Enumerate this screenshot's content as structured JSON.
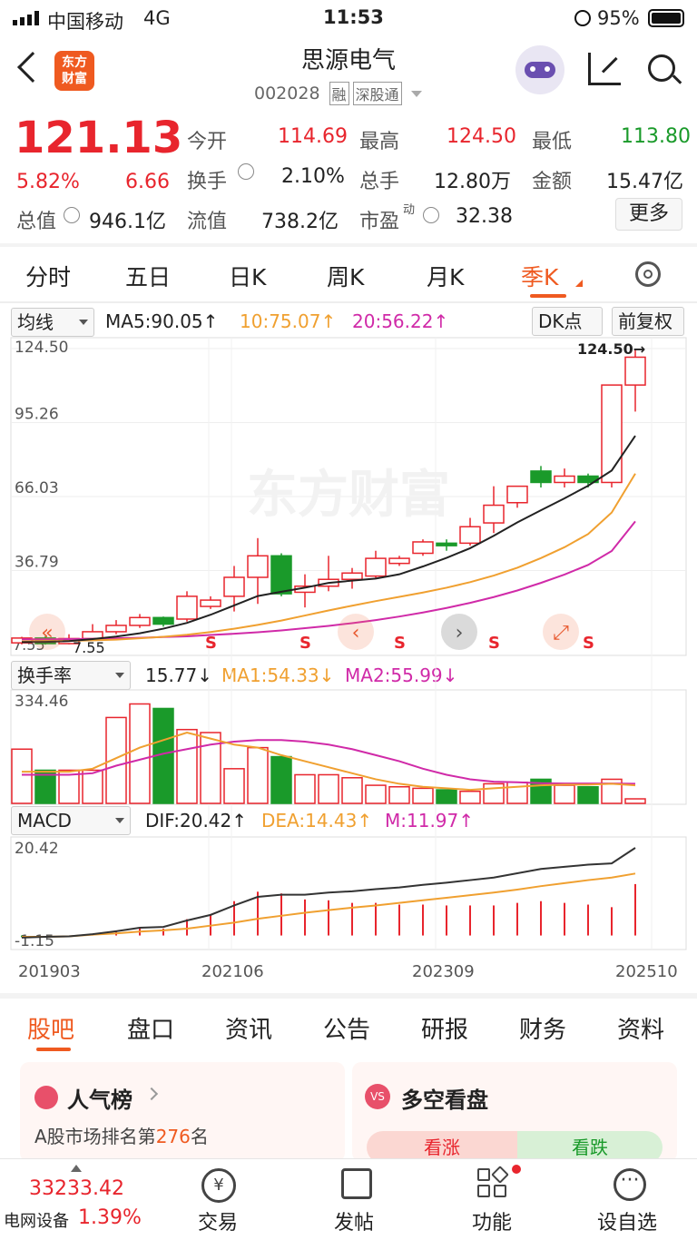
{
  "status": {
    "carrier": "中国移动",
    "network": "4G",
    "time": "11:53",
    "battery": "95%"
  },
  "nav": {
    "logo_line1": "东方",
    "logo_line2": "财富",
    "title": "思源电气",
    "code": "002028",
    "tag1": "融",
    "tag2": "深股通"
  },
  "quote": {
    "price": "121.13",
    "change_pct": "5.82%",
    "change": "6.66",
    "rows": [
      [
        {
          "label": "今开",
          "value": "114.69"
        },
        {
          "label": "最高",
          "value": "124.50"
        },
        {
          "label": "最低",
          "value": "113.80"
        }
      ],
      [
        {
          "label": "换手",
          "value": "2.10%"
        },
        {
          "label": "总手",
          "value": "12.80万"
        },
        {
          "label": "金额",
          "value": "15.47亿"
        }
      ],
      [
        {
          "label": "流值",
          "value": "738.2亿"
        },
        {
          "label": "市盈",
          "sup": "动",
          "value": "32.38"
        }
      ]
    ],
    "total_value_label": "总值",
    "total_value": "946.1亿",
    "more": "更多"
  },
  "tabs": [
    "分时",
    "五日",
    "日K",
    "周K",
    "月K",
    "季K"
  ],
  "active_tab": "季K",
  "ma_bar": {
    "select": "均线",
    "ma5": "MA5:90.05↑",
    "ma10": "10:75.07↑",
    "ma20": "20:56.22↑",
    "dk": "DK点",
    "adj": "前复权"
  },
  "vol_bar": {
    "select": "换手率",
    "val": "15.77↓",
    "ma1": "MA1:54.33↓",
    "ma2": "MA2:55.99↓"
  },
  "macd_bar": {
    "select": "MACD",
    "dif": "DIF:20.42↑",
    "dea": "DEA:14.43↑",
    "m": "M:11.97↑"
  },
  "chart_data": [
    {
      "type": "candlestick",
      "price_axis_labels": [
        "124.50",
        "95.26",
        "66.03",
        "36.79",
        "7.55"
      ],
      "high_marker": "124.50→",
      "low_marker": "7.55",
      "watermark": "东方财富",
      "candles": [
        [
          8.2,
          10.1,
          7.6,
          10.6
        ],
        [
          10.1,
          7.9,
          7.5,
          10.9
        ],
        [
          7.9,
          9.9,
          7.6,
          11.6
        ],
        [
          9.9,
          12.6,
          9.4,
          15.6
        ],
        [
          12.6,
          15.1,
          11.6,
          17.2
        ],
        [
          15.1,
          18.2,
          14.1,
          19.6
        ],
        [
          18.2,
          15.6,
          14.6,
          18.6
        ],
        [
          17.6,
          26.6,
          16.6,
          28.6
        ],
        [
          22.6,
          25.1,
          21.6,
          26.6
        ],
        [
          26.6,
          34.1,
          20.6,
          38.6
        ],
        [
          34.1,
          42.6,
          23.6,
          49.6
        ],
        [
          42.6,
          27.6,
          26.6,
          43.6
        ],
        [
          28.2,
          30.6,
          22.2,
          35.3
        ],
        [
          30.6,
          33.3,
          28.6,
          42.6
        ],
        [
          33.3,
          35.8,
          29.6,
          37.8
        ],
        [
          34.6,
          41.6,
          33.6,
          44.6
        ],
        [
          39.6,
          41.6,
          38.6,
          42.6
        ],
        [
          43.6,
          48.1,
          42.6,
          49.1
        ],
        [
          47.6,
          46.6,
          44.6,
          49.1
        ],
        [
          47.6,
          54.1,
          46.6,
          57.6
        ],
        [
          55.6,
          62.6,
          51.6,
          70.1
        ],
        [
          63.6,
          70.1,
          61.6,
          70.1
        ],
        [
          76.1,
          71.6,
          69.6,
          78.1
        ],
        [
          71.6,
          74.1,
          69.6,
          77.1
        ],
        [
          74.1,
          71.6,
          69.6,
          75.1
        ],
        [
          71.6,
          110.1,
          69.6,
          110.1
        ],
        [
          110.1,
          121.1,
          99.6,
          124.5
        ]
      ],
      "ma5": [
        8.5,
        8.6,
        8.9,
        9.7,
        10.7,
        12.0,
        13.8,
        16.1,
        19.3,
        23.0,
        26.7,
        28.4,
        30.0,
        31.9,
        32.8,
        33.6,
        35.3,
        38.4,
        41.8,
        45.6,
        50.5,
        55.8,
        60.6,
        65.3,
        70.3,
        76.3,
        90.05
      ],
      "ma10": [
        8.8,
        8.9,
        9.0,
        9.2,
        9.5,
        10.0,
        10.6,
        11.4,
        12.5,
        13.8,
        15.3,
        17.0,
        19.0,
        21.0,
        22.9,
        24.7,
        26.4,
        28.1,
        30.0,
        32.2,
        34.8,
        37.9,
        41.7,
        46.0,
        51.2,
        59.7,
        75.07
      ],
      "ma20": [
        9.6,
        9.6,
        9.7,
        9.8,
        10.0,
        10.2,
        10.5,
        10.8,
        11.3,
        11.8,
        12.4,
        13.1,
        14.0,
        14.9,
        16.0,
        17.2,
        18.6,
        20.2,
        22.0,
        24.0,
        26.3,
        28.9,
        31.9,
        35.2,
        39.0,
        44.5,
        56.22
      ],
      "signals": [
        8,
        12,
        16,
        20,
        24
      ],
      "volume_axis_label": "334.46",
      "volume": [
        180,
        110,
        110,
        110,
        285,
        330,
        315,
        245,
        235,
        115,
        185,
        155,
        95,
        95,
        85,
        60,
        55,
        50,
        45,
        40,
        65,
        70,
        80,
        60,
        55,
        80,
        15
      ],
      "vol_ma1": [
        105,
        105,
        105,
        115,
        150,
        185,
        210,
        235,
        215,
        195,
        185,
        160,
        140,
        120,
        100,
        80,
        65,
        55,
        50,
        45,
        50,
        55,
        60,
        62,
        62,
        65,
        60
      ],
      "vol_ma2": [
        95,
        95,
        95,
        100,
        125,
        145,
        165,
        180,
        195,
        205,
        210,
        210,
        205,
        195,
        180,
        160,
        140,
        115,
        95,
        80,
        72,
        70,
        67,
        66,
        66,
        66,
        65
      ],
      "macd_axis_labels": [
        "20.42",
        "-1.15"
      ],
      "dif": [
        -0.5,
        -0.3,
        -0.2,
        0.3,
        1.0,
        1.8,
        2.0,
        3.5,
        4.8,
        7.0,
        9.0,
        9.5,
        9.5,
        10.0,
        10.3,
        10.8,
        11.2,
        11.8,
        12.3,
        12.9,
        13.5,
        14.5,
        15.5,
        16.0,
        16.5,
        16.8,
        20.42
      ],
      "dea": [
        -0.3,
        -0.3,
        -0.2,
        0.2,
        0.5,
        0.9,
        1.2,
        1.6,
        2.3,
        3.0,
        3.9,
        4.6,
        5.3,
        5.9,
        6.5,
        7.0,
        7.6,
        8.2,
        8.8,
        9.4,
        10.0,
        10.7,
        11.5,
        12.2,
        12.9,
        13.5,
        14.43
      ],
      "time_labels": [
        "201903",
        "202106",
        "202309",
        "202510"
      ]
    }
  ],
  "bottom_tabs": [
    "股吧",
    "盘口",
    "资讯",
    "公告",
    "研报",
    "财务",
    "资料"
  ],
  "active_bottom": "股吧",
  "card1": {
    "title": "人气榜",
    "desc_pre": "A股市场排名第",
    "rank": "276",
    "desc_post": "名"
  },
  "card2": {
    "title": "多空看盘",
    "bull": "看涨",
    "bear": "看跌"
  },
  "dock": {
    "index_value": "33233.42",
    "index_name": "电网设备",
    "index_pct": "1.39%",
    "items": [
      "交易",
      "发帖",
      "功能",
      "设自选"
    ]
  }
}
